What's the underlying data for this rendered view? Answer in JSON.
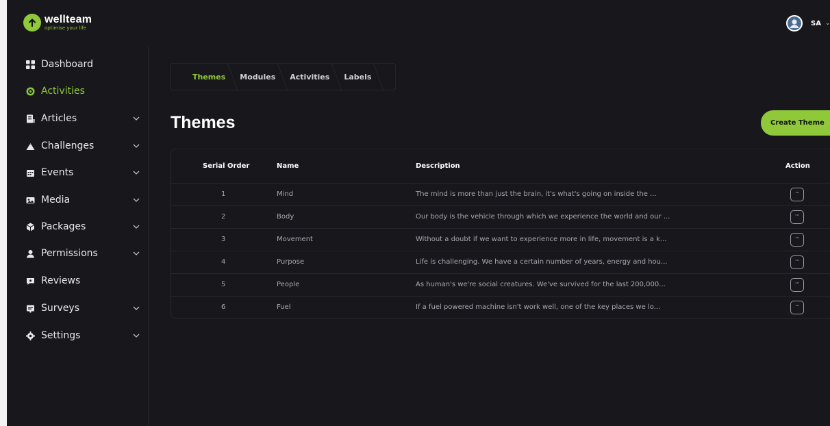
{
  "brand": {
    "name": "wellteam",
    "tagline": "optimise your life",
    "accent_color": "#8fc93a"
  },
  "user": {
    "initials": "SA"
  },
  "sidebar": {
    "items": [
      {
        "label": "Dashboard",
        "icon": "grid-icon",
        "has_submenu": false,
        "active": false
      },
      {
        "label": "Activities",
        "icon": "target-icon",
        "has_submenu": false,
        "active": true
      },
      {
        "label": "Articles",
        "icon": "article-icon",
        "has_submenu": true,
        "active": false
      },
      {
        "label": "Challenges",
        "icon": "mountain-icon",
        "has_submenu": true,
        "active": false
      },
      {
        "label": "Events",
        "icon": "calendar-icon",
        "has_submenu": true,
        "active": false
      },
      {
        "label": "Media",
        "icon": "media-icon",
        "has_submenu": true,
        "active": false
      },
      {
        "label": "Packages",
        "icon": "package-icon",
        "has_submenu": true,
        "active": false
      },
      {
        "label": "Permissions",
        "icon": "user-icon",
        "has_submenu": true,
        "active": false
      },
      {
        "label": "Reviews",
        "icon": "review-icon",
        "has_submenu": false,
        "active": false
      },
      {
        "label": "Surveys",
        "icon": "survey-icon",
        "has_submenu": true,
        "active": false
      },
      {
        "label": "Settings",
        "icon": "gear-icon",
        "has_submenu": true,
        "active": false
      }
    ]
  },
  "breadcrumb": {
    "items": [
      "Themes",
      "Modules",
      "Activities",
      "Labels"
    ]
  },
  "page": {
    "title": "Themes",
    "create_button": "Create Theme"
  },
  "table": {
    "headers": {
      "order": "Serial Order",
      "name": "Name",
      "description": "Description",
      "action": "Action"
    },
    "action_button_glyph": "···",
    "rows": [
      {
        "order": "1",
        "name": "Mind",
        "description": "The mind is more than just the brain, it's what's going on inside the ..."
      },
      {
        "order": "2",
        "name": "Body",
        "description": "Our body is the vehicle through which we experience the world and our ..."
      },
      {
        "order": "3",
        "name": "Movement",
        "description": "Without a doubt if we want to experience more in life, movement is a k..."
      },
      {
        "order": "4",
        "name": "Purpose",
        "description": "Life is challenging. We have a certain number of years, energy and hou..."
      },
      {
        "order": "5",
        "name": "People",
        "description": "As human's we're social creatures. We've survived for the last 200,000..."
      },
      {
        "order": "6",
        "name": "Fuel",
        "description": "If a fuel powered machine isn't work well, one of the key places we lo..."
      }
    ]
  }
}
